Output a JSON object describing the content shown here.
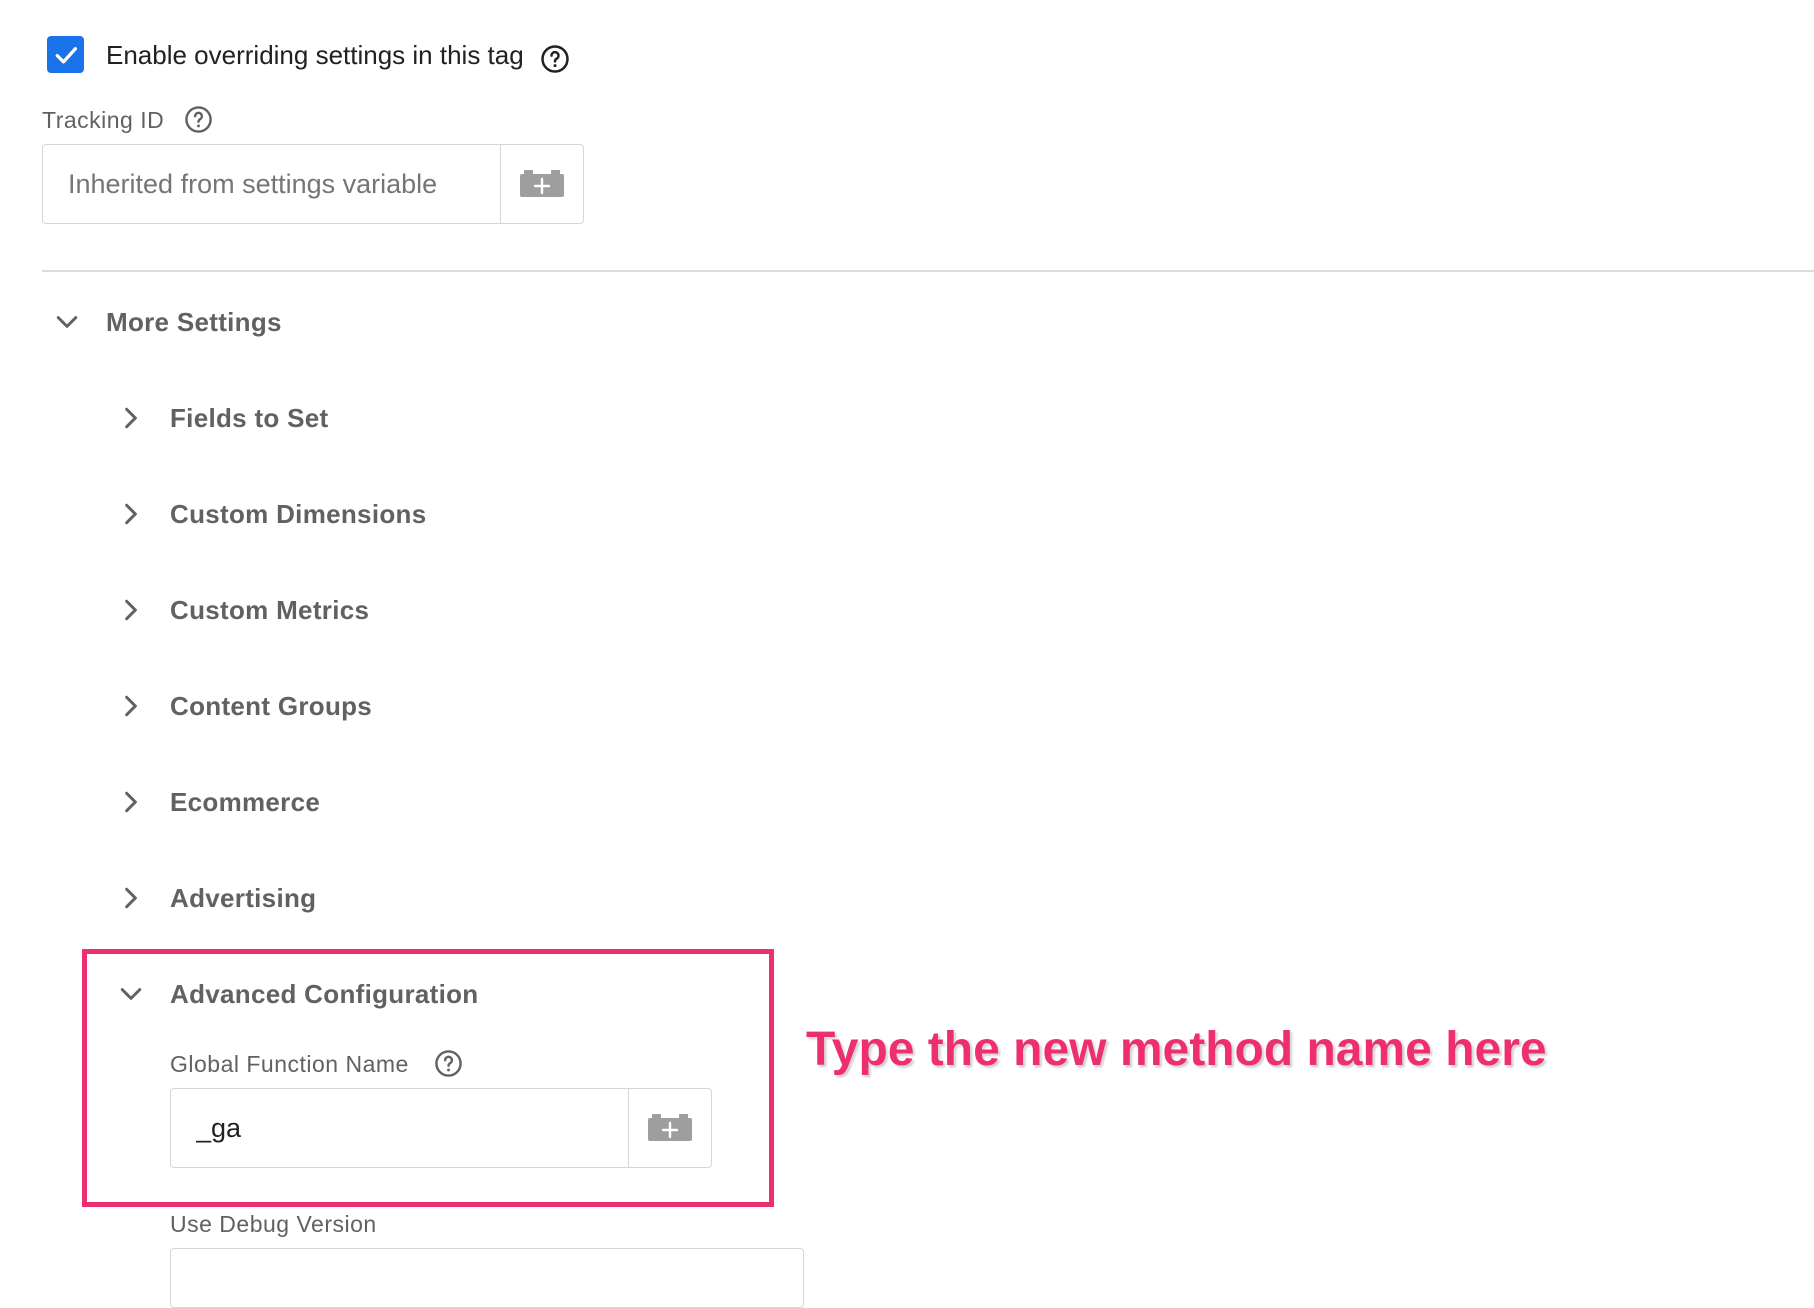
{
  "override": {
    "checked": true,
    "label": "Enable overriding settings in this tag",
    "help_icon": "help-circle-icon"
  },
  "tracking_id": {
    "label": "Tracking ID",
    "placeholder": "Inherited from settings variable",
    "value": "",
    "variable_icon": "add-variable-icon"
  },
  "more_settings": {
    "label": "More Settings",
    "expanded": true,
    "sections": [
      {
        "label": "Fields to Set",
        "expanded": false
      },
      {
        "label": "Custom Dimensions",
        "expanded": false
      },
      {
        "label": "Custom Metrics",
        "expanded": false
      },
      {
        "label": "Content Groups",
        "expanded": false
      },
      {
        "label": "Ecommerce",
        "expanded": false
      },
      {
        "label": "Advertising",
        "expanded": false
      },
      {
        "label": "Advanced Configuration",
        "expanded": true
      }
    ]
  },
  "advanced": {
    "global_function_label": "Global Function Name",
    "global_function_value": "_ga",
    "debug_label": "Use Debug Version"
  },
  "annotation": {
    "text": "Type the new method name here",
    "color": "#ee2f6f"
  },
  "colors": {
    "checkbox": "#1a73e8",
    "label_gray": "#616161",
    "border": "#d6d6d6"
  }
}
